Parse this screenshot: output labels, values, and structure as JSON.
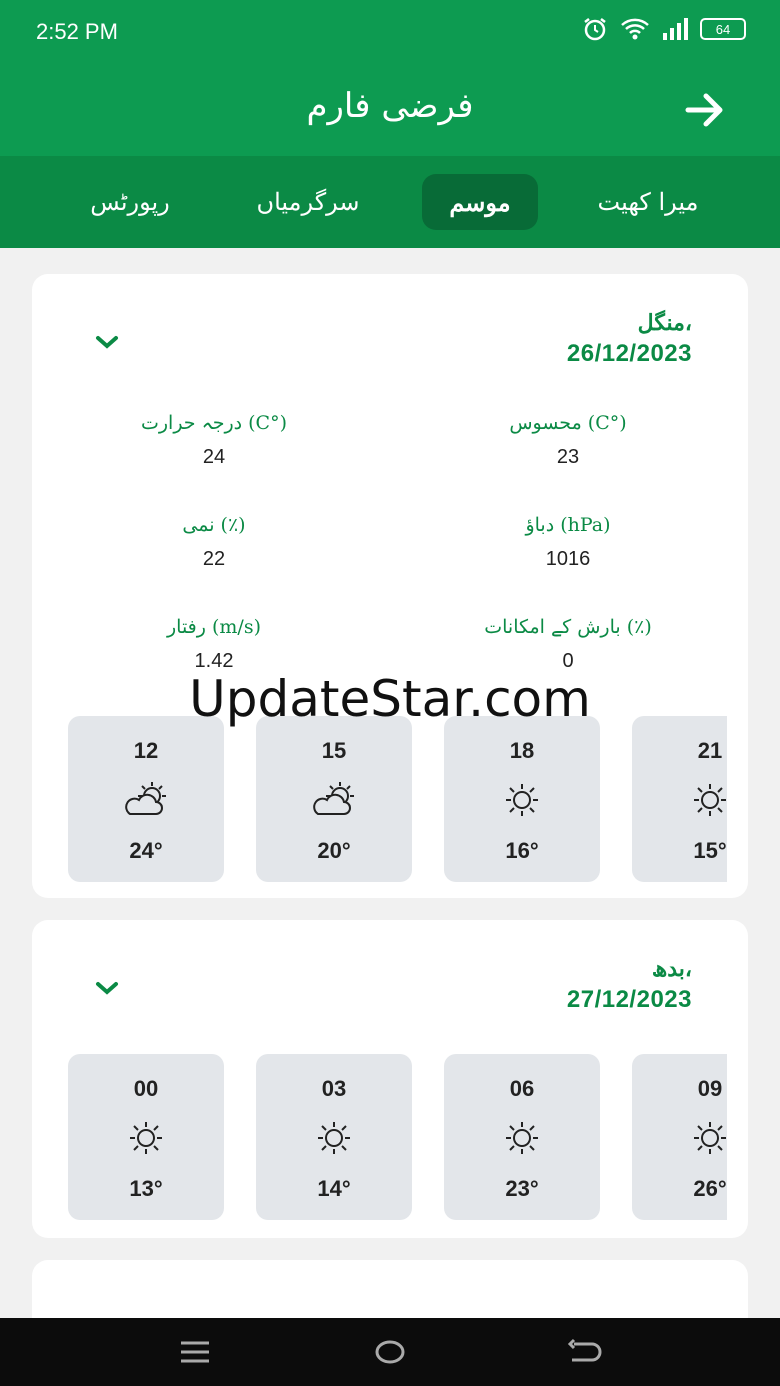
{
  "status": {
    "time": "2:52 PM",
    "battery": "64",
    "icons": [
      "alarm-icon",
      "wifi-icon",
      "signal-icon",
      "battery-icon"
    ]
  },
  "header": {
    "title": "فرضی فارم",
    "back_icon": "arrow-right-icon"
  },
  "tabs": [
    {
      "label": "میرا کھیت",
      "active": false
    },
    {
      "label": "موسم",
      "active": true
    },
    {
      "label": "سرگرمیاں",
      "active": false
    },
    {
      "label": "رپورٹس",
      "active": false
    }
  ],
  "days": [
    {
      "name": "منگل،",
      "date": "26/12/2023",
      "metrics": [
        {
          "label": "درجہ حرارت (C°)",
          "value": "24"
        },
        {
          "label": "محسوس (C°)",
          "value": "23"
        },
        {
          "label": "نمی (٪)",
          "value": "22"
        },
        {
          "label": "دباؤ (hPa)",
          "value": "1016"
        },
        {
          "label": "رفتار (m/s)",
          "value": "1.42"
        },
        {
          "label": "بارش کے امکانات (٪)",
          "value": "0"
        }
      ],
      "hours": [
        {
          "time": "12",
          "icon": "partly-cloudy-icon",
          "temp": "24°"
        },
        {
          "time": "15",
          "icon": "partly-cloudy-icon",
          "temp": "20°"
        },
        {
          "time": "18",
          "icon": "sun-icon",
          "temp": "16°"
        },
        {
          "time": "21",
          "icon": "sun-icon",
          "temp": "15°"
        }
      ]
    },
    {
      "name": "بدھ،",
      "date": "27/12/2023",
      "hours": [
        {
          "time": "00",
          "icon": "sun-icon",
          "temp": "13°"
        },
        {
          "time": "03",
          "icon": "sun-icon",
          "temp": "14°"
        },
        {
          "time": "06",
          "icon": "sun-icon",
          "temp": "23°"
        },
        {
          "time": "09",
          "icon": "sun-icon",
          "temp": "26°"
        }
      ]
    }
  ],
  "watermark": "UpdateStar.com",
  "colors": {
    "primary": "#0d9b51",
    "tab_bar": "#0b8a45",
    "active_tab": "#086b37",
    "tile": "#e3e6ea",
    "accent_text": "#0b8a45"
  }
}
